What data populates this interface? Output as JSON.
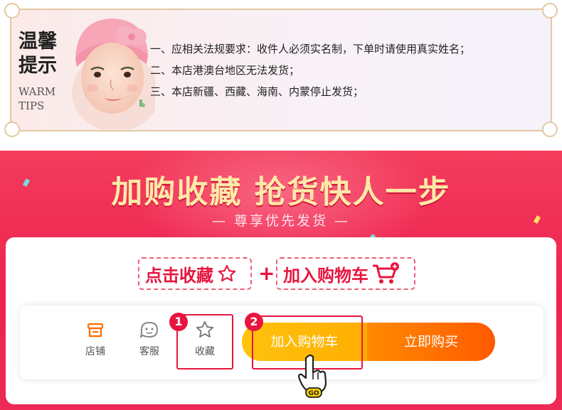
{
  "tips": {
    "title_line1": "温馨",
    "title_line2": "提示",
    "sub_line1": "WARM",
    "sub_line2": "TIPS",
    "items": [
      "一、应相关法规要求：收件人必须实名制，下单时请使用真实姓名；",
      "二、本店港澳台地区无法发货；",
      "三、本店新疆、西藏、海南、内蒙停止发货；"
    ]
  },
  "promo": {
    "headline": "加购收藏 抢货快人一步",
    "subline": "— 尊享优先发货 —",
    "step1_label": "点击收藏",
    "plus": "+",
    "step2_label": "加入购物车",
    "bar": {
      "shop_label": "店铺",
      "service_label": "客服",
      "favorite_label": "收藏",
      "add_cart_label": "加入购物车",
      "buy_now_label": "立即购买",
      "badge1": "1",
      "badge2": "2",
      "go_label": "GO"
    }
  },
  "colors": {
    "accent_red": "#e8153f",
    "headline_gold": "#ffe9a8",
    "cart_yellow": "#ffb800",
    "buy_orange": "#ff6a00"
  },
  "icons": [
    "shop-icon",
    "customer-service-icon",
    "star-icon",
    "cart-icon",
    "pointer-hand-icon"
  ]
}
